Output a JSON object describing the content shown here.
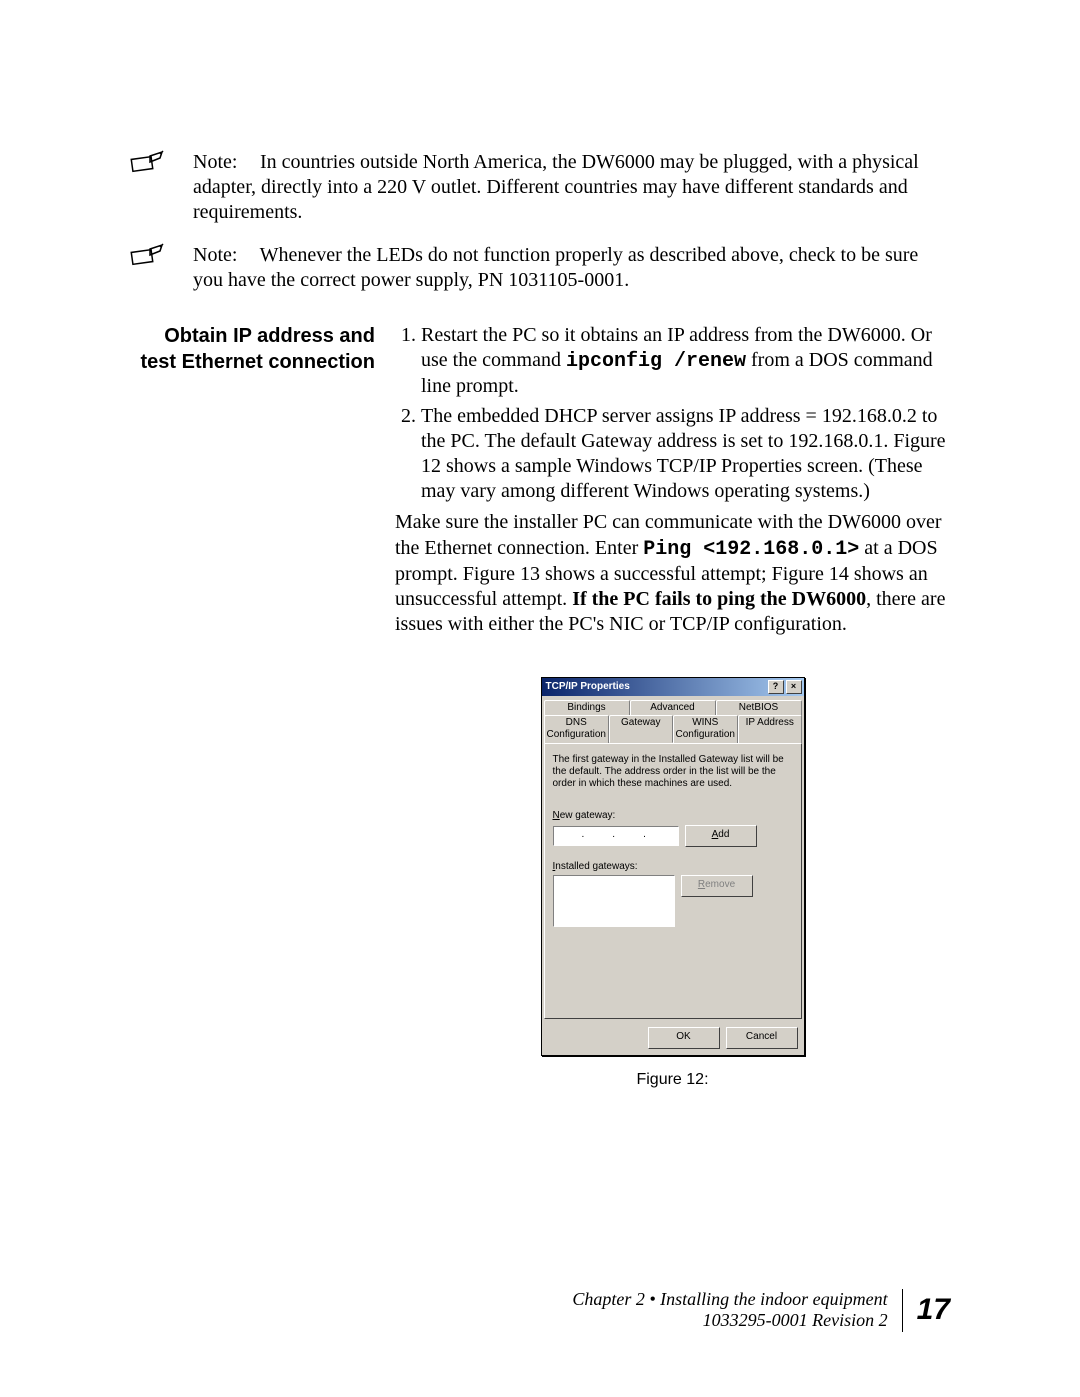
{
  "notes": {
    "label": "Note:",
    "n1": "In countries outside North America, the DW6000 may be plugged, with a physical adapter, directly into a 220 V outlet. Different countries may have different standards and requirements.",
    "n2": "Whenever the LEDs do not function properly as described above, check to be sure you have the correct power supply, PN 1031105-0001."
  },
  "section": {
    "heading": "Obtain IP address and test Ethernet connection",
    "step1_a": "Restart the PC so it obtains an IP address from the DW6000. Or use the command ",
    "step1_cmd": "ipconfig /renew",
    "step1_b": " from a DOS command line prompt.",
    "step2": "The embedded DHCP server assigns IP address = 192.168.0.2 to the PC. The default Gateway address is set to 192.168.0.1. Figure 12 shows a sample Windows TCP/IP Properties screen. (These may vary among different Windows operating systems.)",
    "para_a": "Make sure the installer PC can communicate with the DW6000 over the Ethernet connection. Enter ",
    "para_cmd": "Ping <192.168.0.1>",
    "para_b": " at a DOS prompt. Figure 13 shows a successful attempt; Figure 14 shows an unsuccessful attempt. ",
    "para_bold": "If the PC fails to ping the DW6000",
    "para_c": ", there are issues with either the PC's NIC or TCP/IP configuration."
  },
  "dialog": {
    "title": "TCP/IP Properties",
    "help_btn": "?",
    "close_btn": "×",
    "tabs_back": [
      "Bindings",
      "Advanced",
      "NetBIOS"
    ],
    "tabs_front": [
      "DNS Configuration",
      "Gateway",
      "WINS Configuration",
      "IP Address"
    ],
    "active_tab": "Gateway",
    "panel_text": "The first gateway in the Installed Gateway list will be the default. The address order in the list will be the order in which these machines are used.",
    "new_gw_label_pre": "N",
    "new_gw_label": "ew gateway:",
    "add_btn_pre": "A",
    "add_btn": "dd",
    "installed_label_pre": "I",
    "installed_label": "nstalled gateways:",
    "remove_btn_pre": "R",
    "remove_btn": "emove",
    "ok": "OK",
    "cancel": "Cancel"
  },
  "figure_caption": "Figure 12:",
  "footer": {
    "chapter": "Chapter 2 • Installing the indoor equipment",
    "doc": "1033295-0001  Revision 2",
    "page": "17"
  }
}
